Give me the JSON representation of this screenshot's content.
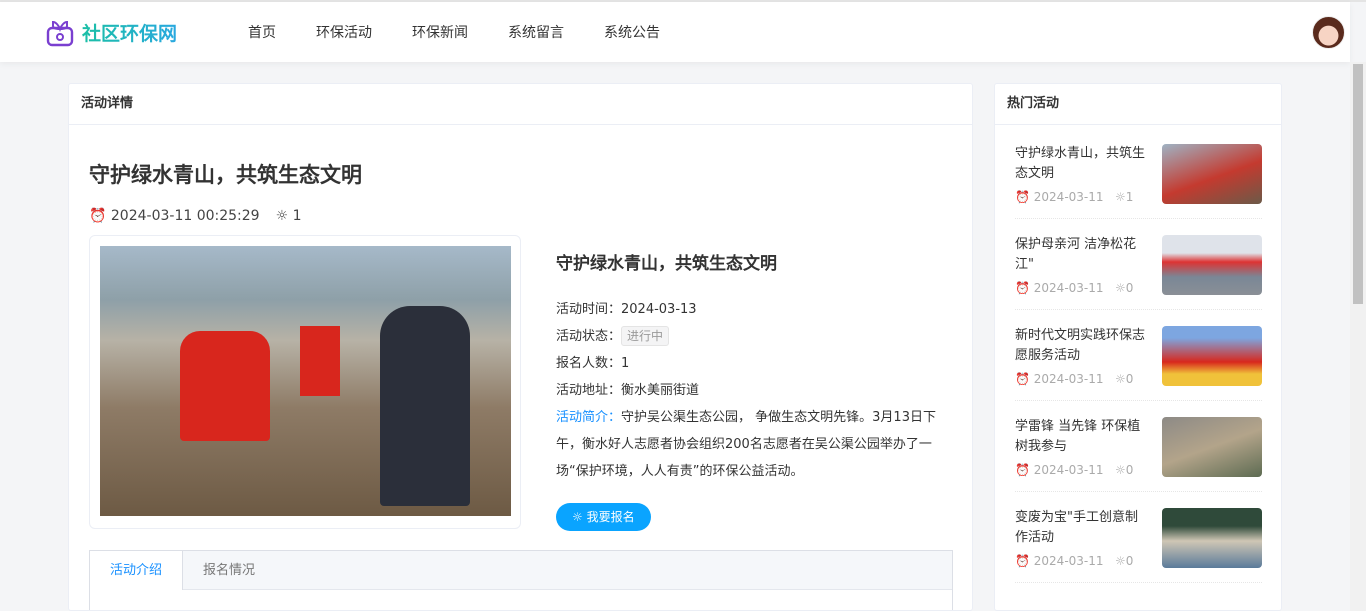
{
  "header": {
    "logo": "社区环保网",
    "nav": [
      "首页",
      "环保活动",
      "环保新闻",
      "系统留言",
      "系统公告"
    ]
  },
  "main": {
    "card_title": "活动详情",
    "title": "守护绿水青山，共筑生态文明",
    "datetime": "2024-03-11 00:25:29",
    "views": "1",
    "info": {
      "title": "守护绿水青山，共筑生态文明",
      "time_label": "活动时间：",
      "time": "2024-03-13",
      "status_label": "活动状态：",
      "status": "进行中",
      "count_label": "报名人数：",
      "count": "1",
      "addr_label": "活动地址：",
      "addr": "衡水美丽街道",
      "intro_label": "活动简介：",
      "intro": "守护吴公渠生态公园， 争做生态文明先锋。3月13日下午，衡水好人志愿者协会组织200名志愿者在吴公渠公园举办了一场“保护环境，人人有责”的环保公益活动。",
      "button": "我要报名"
    },
    "tabs": [
      "活动介绍",
      "报名情况"
    ]
  },
  "side": {
    "card_title": "热门活动",
    "items": [
      {
        "title": "守护绿水青山，共筑生态文明",
        "date": "2024-03-11",
        "views": "1"
      },
      {
        "title": "保护母亲河 洁净松花江\"",
        "date": "2024-03-11",
        "views": "0"
      },
      {
        "title": "新时代文明实践环保志愿服务活动",
        "date": "2024-03-11",
        "views": "0"
      },
      {
        "title": "学雷锋 当先锋 环保植树我参与",
        "date": "2024-03-11",
        "views": "0"
      },
      {
        "title": "变废为宝\"手工创意制作活动",
        "date": "2024-03-11",
        "views": "0"
      }
    ]
  }
}
